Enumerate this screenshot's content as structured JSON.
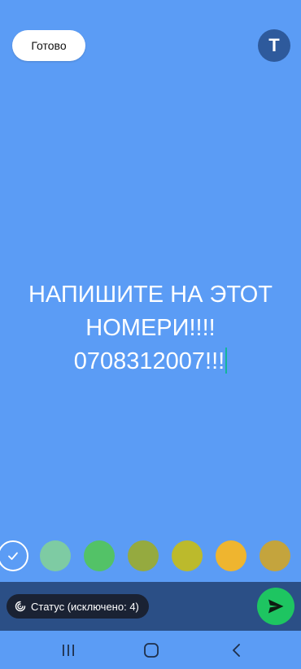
{
  "header": {
    "done_label": "Готово",
    "font_toggle_label": "T"
  },
  "composer": {
    "background_color": "#5b9cf5",
    "text_lines": [
      "НАПИШИТЕ НА ЭТОТ",
      "НОМЕРИ!!!!",
      "0708312007!!!"
    ]
  },
  "colors": {
    "swatches": [
      "#5b9cf5",
      "#7ecba3",
      "#53c267",
      "#95aa3f",
      "#bcba2c",
      "#efb52f",
      "#c4a43d"
    ],
    "selected_index": 0
  },
  "footer": {
    "status_chip_label": "Статус (исключено: 4)",
    "send_icon": "send-icon",
    "send_color": "#1ec561"
  },
  "system_nav": {
    "icons": [
      "recent-apps-icon",
      "home-icon",
      "back-icon"
    ]
  }
}
